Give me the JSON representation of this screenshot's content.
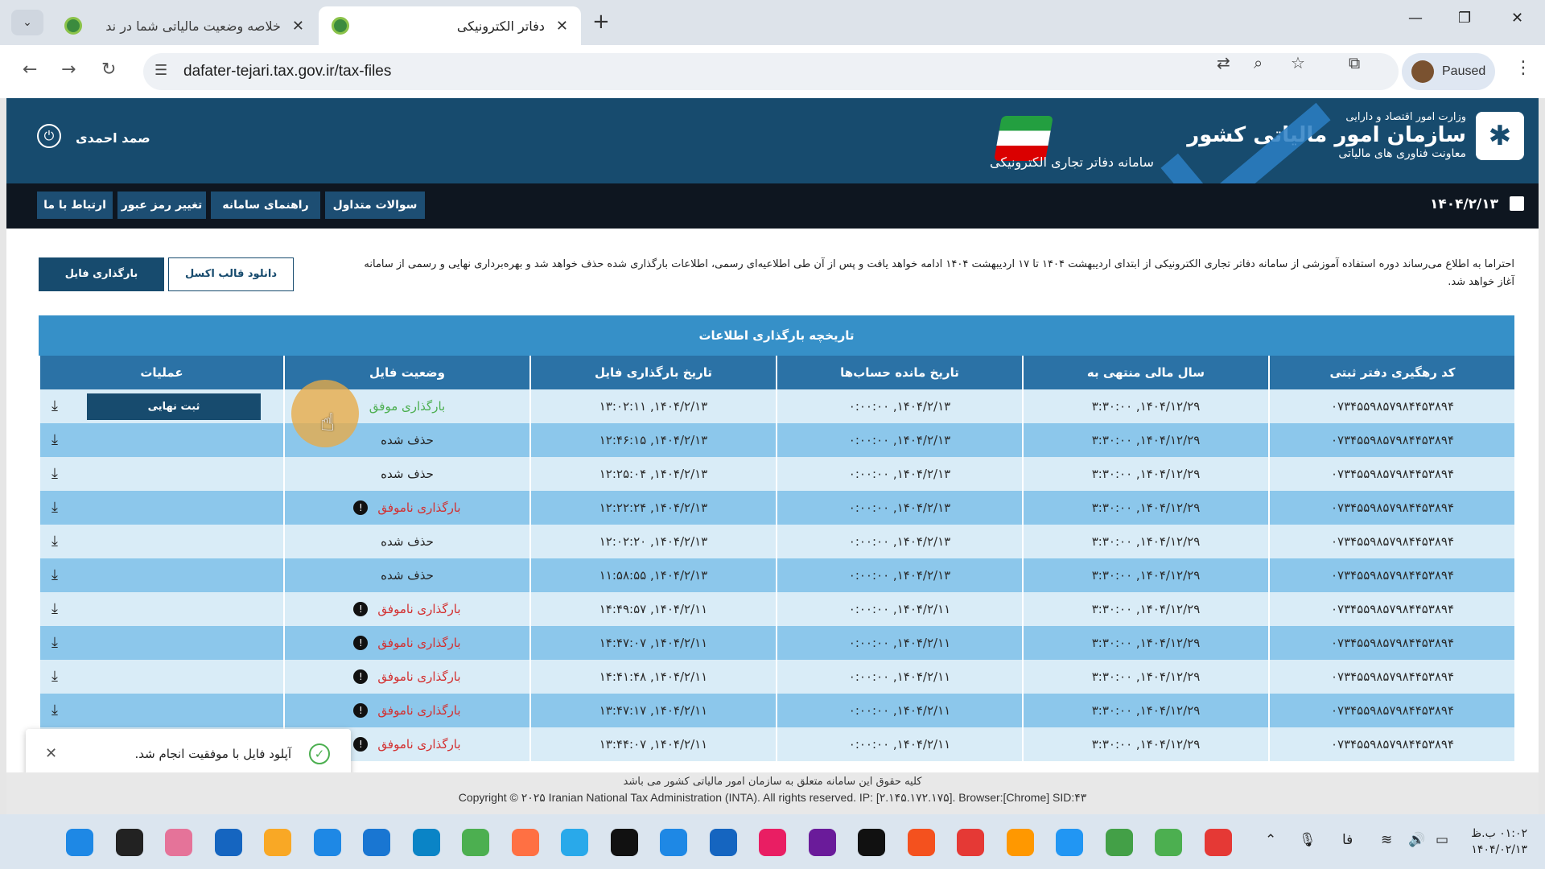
{
  "browser": {
    "tabs": [
      {
        "title": "خلاصه وضعیت مالیاتی شما در ند"
      },
      {
        "title": "دفاتر الکترونیکی"
      }
    ],
    "url": "dafater-tejari.tax.gov.ir/tax-files",
    "profile_label": "Paused"
  },
  "header": {
    "ministry": "وزارت امور اقتصاد و دارایی",
    "org_name": "سازمان امور مالیاتی کشور",
    "dept": "معاونت فناوری های مالیاتی",
    "system_name": "سامانه دفاتر تجاری الکترونیکی",
    "user_name": "صمد احمدی"
  },
  "navbar": {
    "items": [
      "سوالات متداول",
      "راهنمای سامانه",
      "تغییر رمز عبور",
      "ارتباط با ما"
    ],
    "date": "۱۴۰۴/۲/۱۳"
  },
  "notice": "احتراما به اطلاع می‌رساند دوره استفاده آموزشی از سامانه دفاتر تجاری الکترونیکی از ابتدای اردیبهشت ۱۴۰۴ تا ۱۷ اردیبهشت ۱۴۰۴ ادامه خواهد یافت و پس از آن طی اطلاعیه‌ای رسمی، اطلاعات بارگذاری شده حذف خواهد شد و بهره‌برداری نهایی و رسمی از سامانه آغاز خواهد شد.",
  "actions": {
    "upload_label": "بارگذاری فایل",
    "excel_label": "دانلود قالب اکسل"
  },
  "table": {
    "caption": "تاریخچه بارگذاری اطلاعات",
    "columns": [
      "کد رهگیری دفتر ثبتی",
      "سال مالی منتهی به",
      "تاریخ مانده حساب‌ها",
      "تاریخ بارگذاری فایل",
      "وضعیت فایل",
      "عملیات"
    ],
    "finalize_label": "ثبت نهایی",
    "rows": [
      {
        "code": "۰۷۳۴۵۵۹۸۵۷۹۸۴۴۵۳۸۹۴",
        "year": "۱۴۰۴/۱۲/۲۹, ۳:۳۰:۰۰",
        "balance": "۱۴۰۴/۲/۱۳, ۰:۰۰:۰۰",
        "uploaded": "۱۴۰۴/۲/۱۳, ۱۳:۰۲:۱۱",
        "status": "بارگذاری موفق",
        "kind": "success"
      },
      {
        "code": "۰۷۳۴۵۵۹۸۵۷۹۸۴۴۵۳۸۹۴",
        "year": "۱۴۰۴/۱۲/۲۹, ۳:۳۰:۰۰",
        "balance": "۱۴۰۴/۲/۱۳, ۰:۰۰:۰۰",
        "uploaded": "۱۴۰۴/۲/۱۳, ۱۲:۴۶:۱۵",
        "status": "حذف شده",
        "kind": "deleted"
      },
      {
        "code": "۰۷۳۴۵۵۹۸۵۷۹۸۴۴۵۳۸۹۴",
        "year": "۱۴۰۴/۱۲/۲۹, ۳:۳۰:۰۰",
        "balance": "۱۴۰۴/۲/۱۳, ۰:۰۰:۰۰",
        "uploaded": "۱۴۰۴/۲/۱۳, ۱۲:۲۵:۰۴",
        "status": "حذف شده",
        "kind": "deleted"
      },
      {
        "code": "۰۷۳۴۵۵۹۸۵۷۹۸۴۴۵۳۸۹۴",
        "year": "۱۴۰۴/۱۲/۲۹, ۳:۳۰:۰۰",
        "balance": "۱۴۰۴/۲/۱۳, ۰:۰۰:۰۰",
        "uploaded": "۱۴۰۴/۲/۱۳, ۱۲:۲۲:۲۴",
        "status": "بارگذاری ناموفق",
        "kind": "fail"
      },
      {
        "code": "۰۷۳۴۵۵۹۸۵۷۹۸۴۴۵۳۸۹۴",
        "year": "۱۴۰۴/۱۲/۲۹, ۳:۳۰:۰۰",
        "balance": "۱۴۰۴/۲/۱۳, ۰:۰۰:۰۰",
        "uploaded": "۱۴۰۴/۲/۱۳, ۱۲:۰۲:۲۰",
        "status": "حذف شده",
        "kind": "deleted"
      },
      {
        "code": "۰۷۳۴۵۵۹۸۵۷۹۸۴۴۵۳۸۹۴",
        "year": "۱۴۰۴/۱۲/۲۹, ۳:۳۰:۰۰",
        "balance": "۱۴۰۴/۲/۱۳, ۰:۰۰:۰۰",
        "uploaded": "۱۴۰۴/۲/۱۳, ۱۱:۵۸:۵۵",
        "status": "حذف شده",
        "kind": "deleted"
      },
      {
        "code": "۰۷۳۴۵۵۹۸۵۷۹۸۴۴۵۳۸۹۴",
        "year": "۱۴۰۴/۱۲/۲۹, ۳:۳۰:۰۰",
        "balance": "۱۴۰۴/۲/۱۱, ۰:۰۰:۰۰",
        "uploaded": "۱۴۰۴/۲/۱۱, ۱۴:۴۹:۵۷",
        "status": "بارگذاری ناموفق",
        "kind": "fail"
      },
      {
        "code": "۰۷۳۴۵۵۹۸۵۷۹۸۴۴۵۳۸۹۴",
        "year": "۱۴۰۴/۱۲/۲۹, ۳:۳۰:۰۰",
        "balance": "۱۴۰۴/۲/۱۱, ۰:۰۰:۰۰",
        "uploaded": "۱۴۰۴/۲/۱۱, ۱۴:۴۷:۰۷",
        "status": "بارگذاری ناموفق",
        "kind": "fail"
      },
      {
        "code": "۰۷۳۴۵۵۹۸۵۷۹۸۴۴۵۳۸۹۴",
        "year": "۱۴۰۴/۱۲/۲۹, ۳:۳۰:۰۰",
        "balance": "۱۴۰۴/۲/۱۱, ۰:۰۰:۰۰",
        "uploaded": "۱۴۰۴/۲/۱۱, ۱۴:۴۱:۴۸",
        "status": "بارگذاری ناموفق",
        "kind": "fail"
      },
      {
        "code": "۰۷۳۴۵۵۹۸۵۷۹۸۴۴۵۳۸۹۴",
        "year": "۱۴۰۴/۱۲/۲۹, ۳:۳۰:۰۰",
        "balance": "۱۴۰۴/۲/۱۱, ۰:۰۰:۰۰",
        "uploaded": "۱۴۰۴/۲/۱۱, ۱۳:۴۷:۱۷",
        "status": "بارگذاری ناموفق",
        "kind": "fail"
      },
      {
        "code": "۰۷۳۴۵۵۹۸۵۷۹۸۴۴۵۳۸۹۴",
        "year": "۱۴۰۴/۱۲/۲۹, ۳:۳۰:۰۰",
        "balance": "۱۴۰۴/۲/۱۱, ۰:۰۰:۰۰",
        "uploaded": "۱۴۰۴/۲/۱۱, ۱۳:۴۴:۰۷",
        "status": "بارگذاری ناموفق",
        "kind": "fail"
      }
    ]
  },
  "toast": {
    "message": "آپلود فایل با موفقیت انجام شد."
  },
  "footer": {
    "rights_fa": "کلیه حقوق این سامانه متعلق به سازمان امور مالیاتی کشور می باشد",
    "copyright": "Copyright © ۲۰۲۵ Iranian National Tax Administration (INTA). All rights reserved. IP: [۲.۱۴۵.۱۷۲.۱۷۵]. Browser:[Chrome] SID:۴۳"
  },
  "taskbar": {
    "lang": "فا",
    "time": "۰۱:۰۲ ب.ظ",
    "date": "۱۴۰۴/۰۲/۱۳",
    "app_colors": [
      "#1e88e5",
      "#222222",
      "#e57399",
      "#1565c0",
      "#f9a825",
      "#1e88e5",
      "#1976d2",
      "#0a84c6",
      "#4caf50",
      "#ff7043",
      "#29a9ea",
      "#111111",
      "#1e88e5",
      "#1565c0",
      "#e91e63",
      "#6a1b9a",
      "#111111",
      "#f4511e",
      "#e53935",
      "#ff9800",
      "#2196f3",
      "#43a047",
      "#4caf50",
      "#e53935"
    ]
  }
}
